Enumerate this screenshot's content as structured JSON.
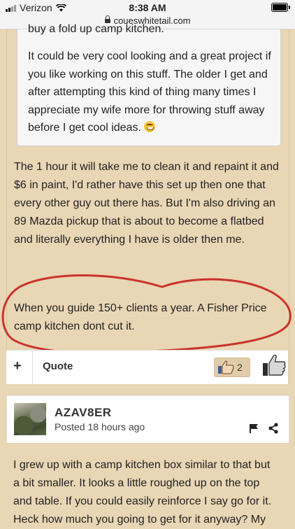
{
  "status_bar": {
    "carrier": "Verizon",
    "time": "8:38 AM"
  },
  "browser": {
    "url": "coueswhitetail.com"
  },
  "post1": {
    "quote_cutoff": "buy a fold up camp kitchen.",
    "quote_text": "It could be very cool looking and a great project if you like working on this stuff. The older I get and after attempting this kind of thing many times I appreciate my wife more for throwing stuff away before I get cool ideas.",
    "paragraph1": "The 1 hour it will take me to clean it and repaint it and $6 in paint, I'd rather have this set up then one that every other guy out there has. But I'm also driving an 89 Mazda pickup that is about to become a flatbed and literally everything I have is older then me.",
    "paragraph2": "When you guide 150+ clients a year. A Fisher Price camp kitchen dont cut it.",
    "actions": {
      "plus": "+",
      "quote": "Quote",
      "like_count": "2"
    },
    "annotation_color": "#c8342a"
  },
  "post2": {
    "username": "AZAV8ER",
    "posted": "Posted 18 hours ago",
    "body": "I grew up with a camp kitchen box similar to that but a bit smaller. It looks a little roughed up on the top and table. If you could easily reinforce I say go for it. Heck how much you going to get for it anyway? My"
  },
  "icons": [
    "wifi-icon",
    "lock-icon",
    "grin-emoji-icon",
    "thumbs-up-icon",
    "flag-icon",
    "share-icon"
  ]
}
